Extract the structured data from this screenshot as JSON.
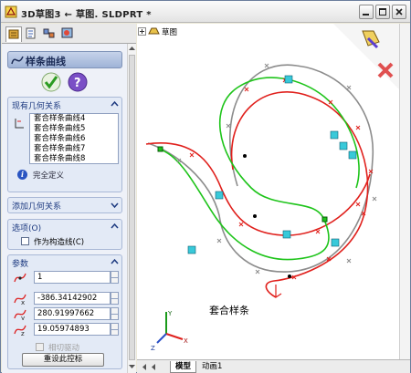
{
  "window": {
    "title": "3D草图3 ← 草图. SLDPRT *"
  },
  "manager": {
    "title": "样条曲线",
    "relations_header": "现有几何关系",
    "relations": [
      "套合样条曲线4",
      "套合样条曲线5",
      "套合样条曲线6",
      "套合样条曲线7",
      "套合样条曲线8"
    ],
    "status": "完全定义",
    "add_relations_header": "添加几何关系",
    "options_header": "选项(O)",
    "construction_label": "作为构造线(C)",
    "params_header": "参数",
    "param_count": "1",
    "param_x": "-386.34142902",
    "param_y": "280.91997662",
    "param_z": "19.05974893",
    "tangent_label": "相切驱动",
    "reset_label": "重设此控标"
  },
  "canvas": {
    "tree_label": "草图",
    "note": "套合样条",
    "tab_model": "模型",
    "tab_anim": "动画1"
  },
  "colors": {
    "red_curve": "#e0201c",
    "green_curve": "#1ec41a",
    "gray_curve": "#8c8c8c",
    "panel_bg": "#eef1f8",
    "header_blue": "#1d3a80"
  }
}
